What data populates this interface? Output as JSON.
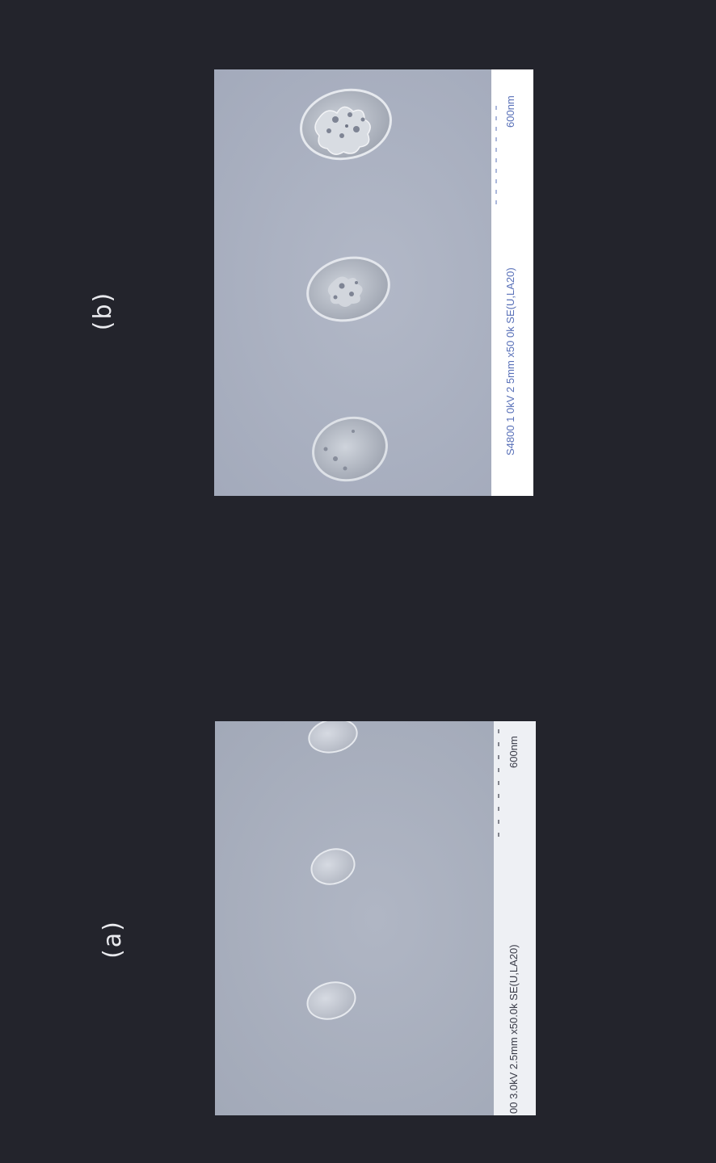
{
  "panels": [
    {
      "label": "(b)",
      "info_bar": "S4800 1 0kV 2 5mm x50 0k SE(U,LA20)",
      "scale_label": "600nm"
    },
    {
      "label": "(a)",
      "info_bar": "00 3.0kV 2.5mm x50.0k SE(U,LA20)",
      "scale_label": "600nm"
    }
  ]
}
